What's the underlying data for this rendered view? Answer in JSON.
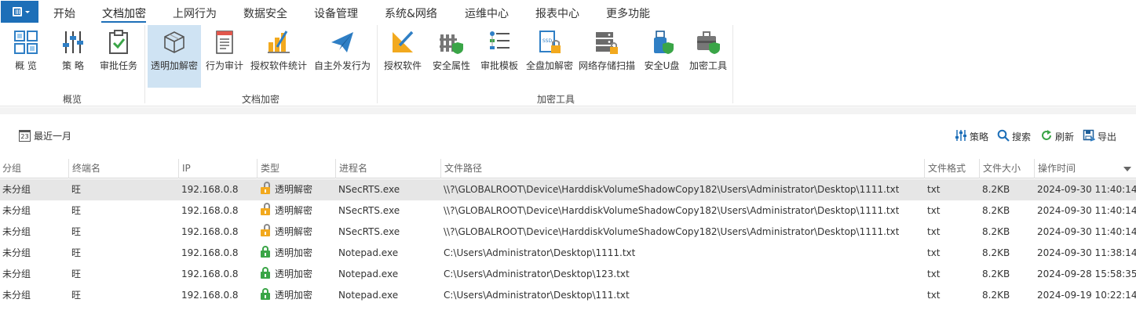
{
  "menubar": {
    "items": [
      "开始",
      "文档加密",
      "上网行为",
      "数据安全",
      "设备管理",
      "系统&网络",
      "运维中心",
      "报表中心",
      "更多功能"
    ],
    "active_index": 1
  },
  "ribbon": {
    "groups": [
      {
        "label": "概览",
        "buttons": [
          {
            "label": "概 览",
            "icon": "overview-grid-icon"
          },
          {
            "label": "策 略",
            "icon": "policy-sliders-icon"
          },
          {
            "label": "审批任务",
            "icon": "approval-clipboard-icon"
          }
        ]
      },
      {
        "label": "文档加密",
        "buttons": [
          {
            "label": "透明加解密",
            "icon": "transparent-crypto-cube-icon",
            "active": true
          },
          {
            "label": "行为审计",
            "icon": "behavior-audit-document-icon"
          },
          {
            "label": "授权软件统计",
            "icon": "licensed-software-stats-icon"
          },
          {
            "label": "自主外发行为",
            "icon": "send-paper-plane-icon"
          }
        ]
      },
      {
        "label": "加密工具",
        "buttons": [
          {
            "label": "授权软件",
            "icon": "licensed-software-icon"
          },
          {
            "label": "安全属性",
            "icon": "security-attribute-icon"
          },
          {
            "label": "审批模板",
            "icon": "approval-template-icon"
          },
          {
            "label": "全盘加解密",
            "icon": "full-disk-crypto-icon"
          },
          {
            "label": "网络存储扫描",
            "icon": "network-storage-scan-icon"
          },
          {
            "label": "安全U盘",
            "icon": "secure-usb-icon"
          },
          {
            "label": "加密工具",
            "icon": "encryption-toolbox-icon"
          }
        ]
      }
    ]
  },
  "toolbar": {
    "date_filter": "最近一月",
    "calendar_day": "23",
    "actions": [
      {
        "label": "策略",
        "icon": "policy-sliders-icon"
      },
      {
        "label": "搜索",
        "icon": "search-icon"
      },
      {
        "label": "刷新",
        "icon": "refresh-icon"
      },
      {
        "label": "导出",
        "icon": "export-icon"
      }
    ]
  },
  "table": {
    "columns": [
      "分组",
      "终端名",
      "IP",
      "类型",
      "进程名",
      "文件路径",
      "文件格式",
      "文件大小",
      "操作时间"
    ],
    "sort_column": "操作时间",
    "sort_direction": "desc",
    "selected_row": 0,
    "rows": [
      {
        "group": "未分组",
        "terminal": "旺",
        "ip": "192.168.0.8",
        "type": "透明解密",
        "lock": "open",
        "process": "NSecRTS.exe",
        "path": "\\\\?\\GLOBALROOT\\Device\\HarddiskVolumeShadowCopy182\\Users\\Administrator\\Desktop\\1111.txt",
        "format": "txt",
        "size": "8.2KB",
        "time": "2024-09-30 11:40:14"
      },
      {
        "group": "未分组",
        "terminal": "旺",
        "ip": "192.168.0.8",
        "type": "透明解密",
        "lock": "open",
        "process": "NSecRTS.exe",
        "path": "\\\\?\\GLOBALROOT\\Device\\HarddiskVolumeShadowCopy182\\Users\\Administrator\\Desktop\\1111.txt",
        "format": "txt",
        "size": "8.2KB",
        "time": "2024-09-30 11:40:14"
      },
      {
        "group": "未分组",
        "terminal": "旺",
        "ip": "192.168.0.8",
        "type": "透明解密",
        "lock": "open",
        "process": "NSecRTS.exe",
        "path": "\\\\?\\GLOBALROOT\\Device\\HarddiskVolumeShadowCopy182\\Users\\Administrator\\Desktop\\1111.txt",
        "format": "txt",
        "size": "8.2KB",
        "time": "2024-09-30 11:40:14"
      },
      {
        "group": "未分组",
        "terminal": "旺",
        "ip": "192.168.0.8",
        "type": "透明加密",
        "lock": "closed",
        "process": "Notepad.exe",
        "path": "C:\\Users\\Administrator\\Desktop\\1111.txt",
        "format": "txt",
        "size": "8.2KB",
        "time": "2024-09-30 11:38:14"
      },
      {
        "group": "未分组",
        "terminal": "旺",
        "ip": "192.168.0.8",
        "type": "透明加密",
        "lock": "closed",
        "process": "Notepad.exe",
        "path": "C:\\Users\\Administrator\\Desktop\\123.txt",
        "format": "txt",
        "size": "8.2KB",
        "time": "2024-09-28 15:58:35"
      },
      {
        "group": "未分组",
        "terminal": "旺",
        "ip": "192.168.0.8",
        "type": "透明加密",
        "lock": "closed",
        "process": "Notepad.exe",
        "path": "C:\\Users\\Administrator\\Desktop\\111.txt",
        "format": "txt",
        "size": "8.2KB",
        "time": "2024-09-19 10:22:14"
      }
    ]
  },
  "colors": {
    "accent": "#1d6fb8",
    "active_button_bg": "#cfe3f3",
    "selected_row_bg": "#e6e6e6",
    "open_lock": "#f2a91e",
    "closed_lock": "#3aa547"
  }
}
